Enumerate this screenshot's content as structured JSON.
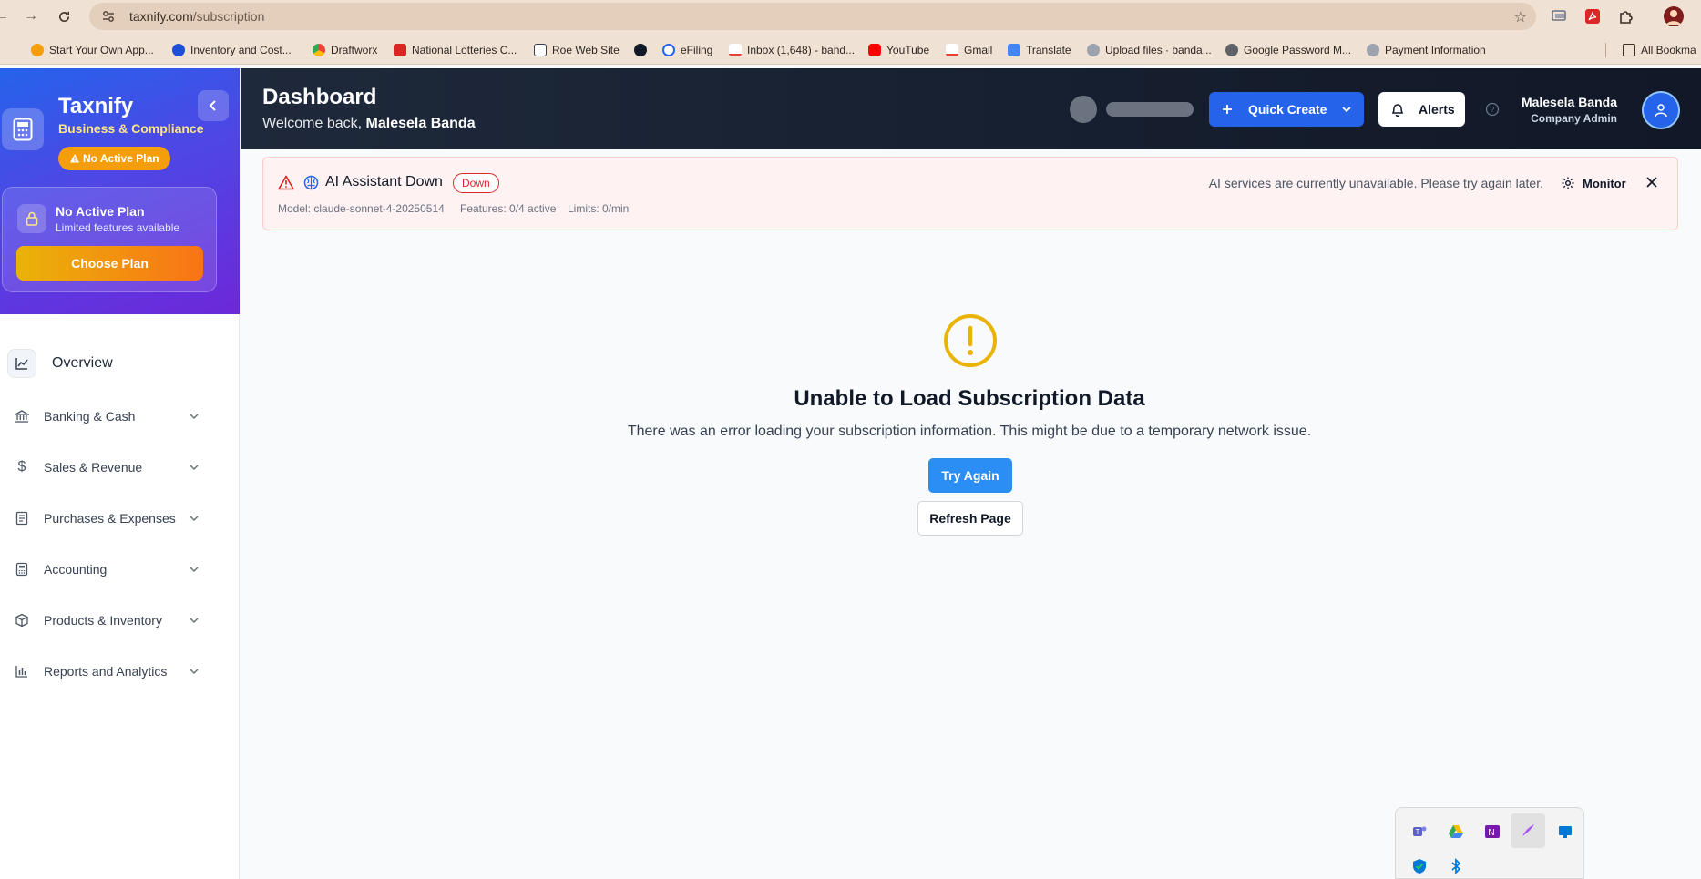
{
  "browser": {
    "url_host": "taxnify.com",
    "url_path": "/subscription",
    "bookmarks": [
      {
        "label": "Start Your Own App...",
        "color": "#f59e0b"
      },
      {
        "label": "Inventory and Cost...",
        "color": "#1d4ed8"
      },
      {
        "label": "Draftworx",
        "color": "#f97316"
      },
      {
        "label": "National Lotteries C...",
        "color": "#dc2626"
      },
      {
        "label": "Roe Web Site",
        "color": "#374151"
      },
      {
        "label": "",
        "color": "#111827"
      },
      {
        "label": "eFiling",
        "color": "#2563eb"
      },
      {
        "label": "Inbox (1,648) - band...",
        "color": "#ea4335"
      },
      {
        "label": "YouTube",
        "color": "#ff0000"
      },
      {
        "label": "Gmail",
        "color": "#ea4335"
      },
      {
        "label": "Translate",
        "color": "#4285f4"
      },
      {
        "label": "Upload files · banda...",
        "color": "#6b7280"
      },
      {
        "label": "Google Password M...",
        "color": "#5f6368"
      },
      {
        "label": "Payment Information",
        "color": "#6b7280"
      }
    ],
    "all_bookmarks": "All Bookma"
  },
  "sidebar": {
    "brand": "Taxnify",
    "brand_subtitle": "Business & Compliance",
    "plan_pill": "No Active Plan",
    "plan_card": {
      "title": "No Active Plan",
      "description": "Limited features available",
      "button": "Choose Plan"
    },
    "overview": "Overview",
    "items": [
      {
        "label": "Banking & Cash",
        "icon": "bank-icon"
      },
      {
        "label": "Sales & Revenue",
        "icon": "dollar-icon"
      },
      {
        "label": "Purchases & Expenses",
        "icon": "receipt-icon"
      },
      {
        "label": "Accounting",
        "icon": "calculator-icon"
      },
      {
        "label": "Products & Inventory",
        "icon": "box-icon"
      },
      {
        "label": "Reports and Analytics",
        "icon": "bar-chart-icon"
      }
    ]
  },
  "header": {
    "title": "Dashboard",
    "welcome_prefix": "Welcome back,",
    "welcome_name": "Malesela Banda",
    "quick_create": "Quick Create",
    "alerts": "Alerts",
    "user_name": "Malesela Banda",
    "user_role": "Company Admin"
  },
  "ai_banner": {
    "title": "AI Assistant Down",
    "badge": "Down",
    "model": "Model: claude-sonnet-4-20250514",
    "features": "Features: 0/4 active",
    "limits": "Limits: 0/min",
    "message": "AI services are currently unavailable. Please try again later.",
    "monitor": "Monitor"
  },
  "error": {
    "title": "Unable to Load Subscription Data",
    "description": "There was an error loading your subscription information. This might be due to a temporary network issue.",
    "try_again": "Try Again",
    "refresh": "Refresh Page"
  },
  "colors": {
    "accent": "#2563eb",
    "warning": "#eab308",
    "danger": "#dc2626",
    "header_bg": "#111827"
  }
}
